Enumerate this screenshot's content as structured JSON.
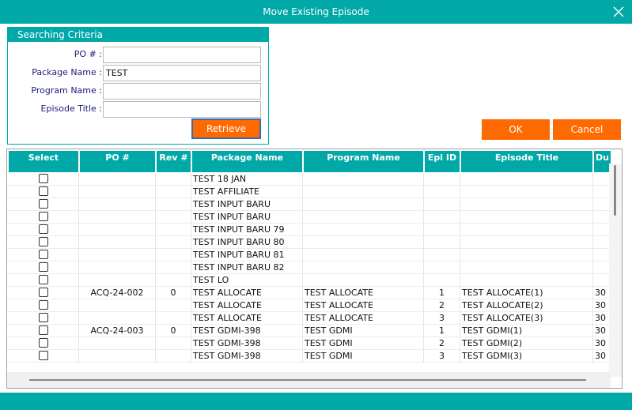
{
  "window": {
    "title": "Move Existing Episode"
  },
  "criteria": {
    "heading": "Searching Criteria",
    "fields": [
      {
        "label": "PO # :",
        "value": ""
      },
      {
        "label": "Package Name :",
        "value": "TEST"
      },
      {
        "label": "Program Name :",
        "value": ""
      },
      {
        "label": "Episode Title :",
        "value": ""
      }
    ],
    "retrieve_label": "Retrieve"
  },
  "actions": {
    "ok_label": "OK",
    "cancel_label": "Cancel"
  },
  "colors": {
    "accent": "#00a8a8",
    "button": "#ff6a00"
  },
  "grid": {
    "columns": [
      "Select",
      "PO #",
      "Rev #",
      "Package Name",
      "Program Name",
      "Epi ID",
      "Episode Title",
      "Du"
    ],
    "rows": [
      {
        "po": "",
        "rev": "",
        "package": "TEST 18 JAN",
        "program": "",
        "epi": "",
        "title": "",
        "dur": ""
      },
      {
        "po": "",
        "rev": "",
        "package": "TEST AFFILIATE",
        "program": "",
        "epi": "",
        "title": "",
        "dur": ""
      },
      {
        "po": "",
        "rev": "",
        "package": "TEST INPUT BARU",
        "program": "",
        "epi": "",
        "title": "",
        "dur": ""
      },
      {
        "po": "",
        "rev": "",
        "package": "TEST INPUT BARU",
        "program": "",
        "epi": "",
        "title": "",
        "dur": ""
      },
      {
        "po": "",
        "rev": "",
        "package": "TEST INPUT BARU 79",
        "program": "",
        "epi": "",
        "title": "",
        "dur": ""
      },
      {
        "po": "",
        "rev": "",
        "package": "TEST INPUT BARU 80",
        "program": "",
        "epi": "",
        "title": "",
        "dur": ""
      },
      {
        "po": "",
        "rev": "",
        "package": "TEST INPUT BARU 81",
        "program": "",
        "epi": "",
        "title": "",
        "dur": ""
      },
      {
        "po": "",
        "rev": "",
        "package": "TEST INPUT BARU 82",
        "program": "",
        "epi": "",
        "title": "",
        "dur": ""
      },
      {
        "po": "",
        "rev": "",
        "package": "TEST LO",
        "program": "",
        "epi": "",
        "title": "",
        "dur": ""
      },
      {
        "po": "ACQ-24-002",
        "rev": "0",
        "package": "TEST ALLOCATE",
        "program": "TEST ALLOCATE",
        "epi": "1",
        "title": "TEST ALLOCATE(1)",
        "dur": "30"
      },
      {
        "po": "",
        "rev": "",
        "package": "TEST ALLOCATE",
        "program": "TEST ALLOCATE",
        "epi": "2",
        "title": "TEST ALLOCATE(2)",
        "dur": "30"
      },
      {
        "po": "",
        "rev": "",
        "package": "TEST ALLOCATE",
        "program": "TEST ALLOCATE",
        "epi": "3",
        "title": "TEST ALLOCATE(3)",
        "dur": "30"
      },
      {
        "po": "ACQ-24-003",
        "rev": "0",
        "package": "TEST GDMI-398",
        "program": "TEST GDMI",
        "epi": "1",
        "title": "TEST GDMI(1)",
        "dur": "30"
      },
      {
        "po": "",
        "rev": "",
        "package": "TEST GDMI-398",
        "program": "TEST GDMI",
        "epi": "2",
        "title": "TEST GDMI(2)",
        "dur": "30"
      },
      {
        "po": "",
        "rev": "",
        "package": "TEST GDMI-398",
        "program": "TEST GDMI",
        "epi": "3",
        "title": "TEST GDMI(3)",
        "dur": "30"
      }
    ]
  }
}
